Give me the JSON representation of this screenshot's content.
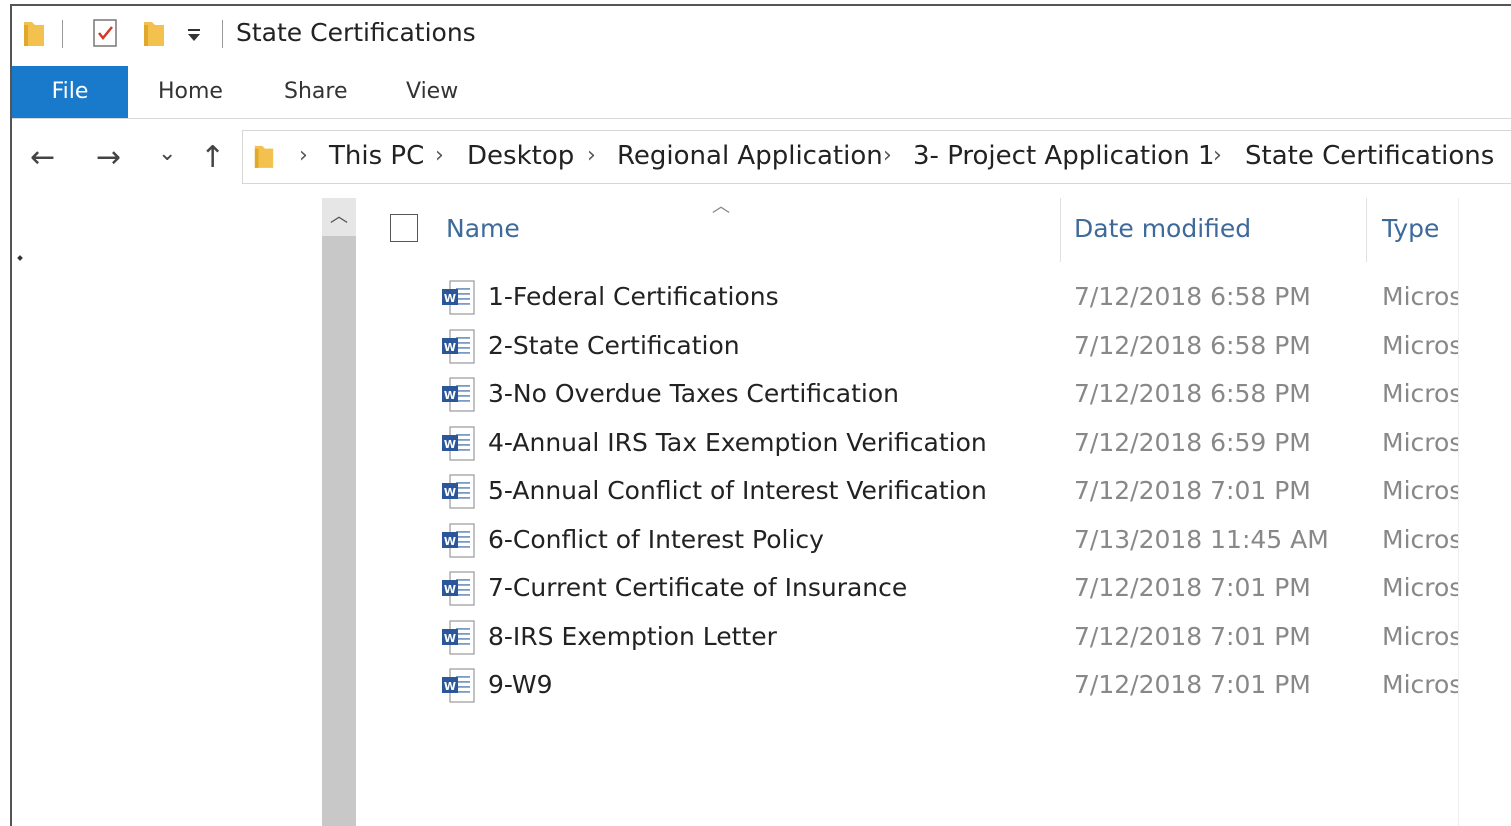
{
  "window": {
    "title": "State Certifications"
  },
  "ribbon": {
    "tabs": [
      "File",
      "Home",
      "Share",
      "View"
    ]
  },
  "nav": {
    "back_icon": "←",
    "forward_icon": "→",
    "recent_icon": "⌄",
    "up_icon": "↑",
    "breadcrumb": [
      "This PC",
      "Desktop",
      "Regional Application",
      "3- Project Application 1",
      "State Certifications"
    ]
  },
  "columns": {
    "name": "Name",
    "date": "Date modified",
    "type": "Type"
  },
  "files": [
    {
      "name": "1-Federal Certifications",
      "date": "7/12/2018 6:58 PM",
      "type": "Microsoft Word Document"
    },
    {
      "name": "2-State Certification",
      "date": "7/12/2018 6:58 PM",
      "type": "Microsoft Word Document"
    },
    {
      "name": "3-No Overdue Taxes Certification",
      "date": "7/12/2018 6:58 PM",
      "type": "Microsoft Word Document"
    },
    {
      "name": "4-Annual IRS Tax Exemption Verification",
      "date": "7/12/2018 6:59 PM",
      "type": "Microsoft Word Document"
    },
    {
      "name": "5-Annual Conflict of Interest Verification",
      "date": "7/12/2018 7:01 PM",
      "type": "Microsoft Word Document"
    },
    {
      "name": "6-Conflict of Interest Policy",
      "date": "7/13/2018 11:45 AM",
      "type": "Microsoft Word Document"
    },
    {
      "name": "7-Current Certificate of Insurance",
      "date": "7/12/2018 7:01 PM",
      "type": "Microsoft Word Document"
    },
    {
      "name": "8-IRS Exemption Letter",
      "date": "7/12/2018 7:01 PM",
      "type": "Microsoft Word Document"
    },
    {
      "name": "9-W9",
      "date": "7/12/2018 7:01 PM",
      "type": "Microsoft Word Document"
    }
  ],
  "colors": {
    "file_tab": "#1979ca",
    "header_text": "#3d6a9a",
    "folder": "#f2c14e"
  }
}
